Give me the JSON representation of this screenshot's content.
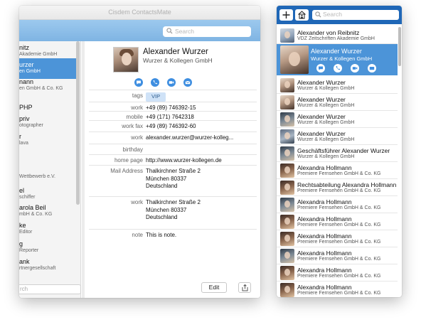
{
  "main_window": {
    "title": "Cisdem ContactsMate",
    "search_placeholder": "Search",
    "bottom_search_placeholder": "rch",
    "list": [
      {
        "name": "nitz",
        "sub": "Akademie GmbH"
      },
      {
        "name": "urzer",
        "sub": "en GmbH",
        "selected": true
      },
      {
        "name": "nann",
        "sub": "en GmbH & Co. KG"
      },
      {
        "name": "PHP",
        "sub": ""
      },
      {
        "name": "priv",
        "sub": "otographer"
      },
      {
        "name": "r",
        "sub": "lava"
      },
      {
        "name": "",
        "sub": "Wettbewerb e.V."
      },
      {
        "name": "el",
        "sub": "schiffer"
      },
      {
        "name": "arola Beil",
        "sub": "mbH & Co. KG"
      },
      {
        "name": "ke",
        "sub": "Editor"
      },
      {
        "name": "g",
        "sub": "Reporter"
      },
      {
        "name": "ank",
        "sub": "rtnergesellschaft"
      }
    ],
    "detail": {
      "name": "Alexander Wurzer",
      "company": "Wurzer & Kollegen GmbH",
      "fields": [
        {
          "label": "tags",
          "value": "VIP",
          "type": "tag"
        },
        {
          "label": "work",
          "value": "+49 (89) 746392-15"
        },
        {
          "label": "mobile",
          "value": "+49 (171) 7642318"
        },
        {
          "label": "work fax",
          "value": "+49 (89) 746392-60"
        },
        {
          "label": "work",
          "value": "alexander.wurzer@wurzer-kolleg..."
        },
        {
          "label": "birthday",
          "value": ""
        },
        {
          "label": "home page",
          "value": "http://www.wurzer-kollegen.de"
        },
        {
          "label": "Mail Address",
          "value": "Thalkirchner Straße 2\nMünchen 80337\nDeutschland"
        },
        {
          "label": "work",
          "value": "Thalkirchner Straße 2\nMünchen 80337\nDeutschland"
        },
        {
          "label": "note",
          "value": "This is note."
        }
      ],
      "edit_label": "Edit"
    }
  },
  "side_panel": {
    "search_placeholder": "Search",
    "contacts": [
      {
        "name": "Alexander von Reibnitz",
        "sub": "VDZ Zeitschriften Akademie GmbH",
        "photo": "d"
      },
      {
        "name": "Alexander Wurzer",
        "sub": "Wurzer & Kollegen GmbH",
        "photo": "a",
        "selected": true
      },
      {
        "name": "Alexander Wurzer",
        "sub": "Wurzer & Kollegen GmbH",
        "photo": "a"
      },
      {
        "name": "Alexander Wurzer",
        "sub": "Wurzer & Kollegen GmbH",
        "photo": "a"
      },
      {
        "name": "Alexander Wurzer",
        "sub": "Wurzer & Kollegen GmbH",
        "photo": "b"
      },
      {
        "name": "Alexander Wurzer",
        "sub": "Wurzer & Kollegen GmbH",
        "photo": "c"
      },
      {
        "name": "Geschäftsführer Alexander Wurzer",
        "sub": "Wurzer & Kollegen GmbH",
        "photo": "b"
      },
      {
        "name": "Alexandra Hollmann",
        "sub": "Premiere Fernsehen GmbH & Co. KG",
        "photo": "e"
      },
      {
        "name": "Rechtsabteilung Alexandra Hollmann",
        "sub": "Premiere Fernsehen GmbH & Co. KG",
        "photo": "e"
      },
      {
        "name": "Alexandra Hollmann",
        "sub": "Premiere Fernsehen GmbH & Co. KG",
        "photo": "b"
      },
      {
        "name": "Alexandra Hollmann",
        "sub": "Premiere Fernsehen GmbH & Co. KG",
        "photo": "e"
      },
      {
        "name": "Alexandra Hollmann",
        "sub": "Premiere Fernsehen GmbH & Co. KG",
        "photo": "e"
      },
      {
        "name": "Alexandra Hollmann",
        "sub": "Premiere Fernsehen GmbH & Co. KG",
        "photo": "b"
      },
      {
        "name": "Alexandra Hollmann",
        "sub": "Premiere Fernsehen GmbH & Co. KG",
        "photo": "e"
      },
      {
        "name": "Alexandra Hollmann",
        "sub": "Premiere Fernsehen GmbH & Co. KG",
        "photo": "e"
      }
    ]
  },
  "colors": {
    "accent": "#1f67b7",
    "selection": "#4c94d8",
    "toolbar": "#8dbfe9",
    "action_icon": "#3e8ee0"
  },
  "icons": {
    "actions": [
      "message-icon",
      "phone-icon",
      "video-icon",
      "mail-icon"
    ],
    "toolbar": [
      "add-icon",
      "contacts-icon",
      "search-icon"
    ],
    "share": "share-icon"
  }
}
